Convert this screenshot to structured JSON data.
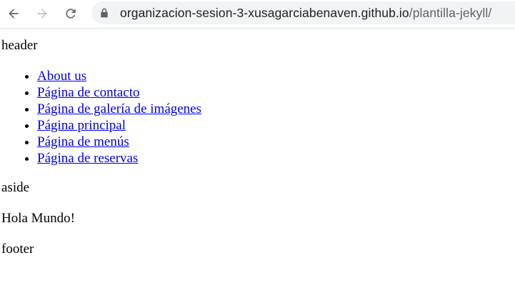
{
  "browser": {
    "url_domain": "organizacion-sesion-3-xusagarciabenaven.github.io",
    "url_path": "/plantilla-jekyll/",
    "back_icon": "back-arrow-icon",
    "forward_icon": "forward-arrow-icon",
    "reload_icon": "reload-icon",
    "lock_icon": "lock-icon"
  },
  "page": {
    "header": "header",
    "nav_links": [
      "About us",
      "Página de contacto",
      "Página de galería de imágenes",
      "Página principal",
      "Página de menús",
      "Página de reservas"
    ],
    "aside": "aside",
    "main": "Hola Mundo!",
    "footer": "footer"
  },
  "colors": {
    "link": "#0000ee",
    "text": "#000000",
    "omnibox_bg": "#f1f3f4",
    "toolbar_icon": "#5f6368"
  }
}
